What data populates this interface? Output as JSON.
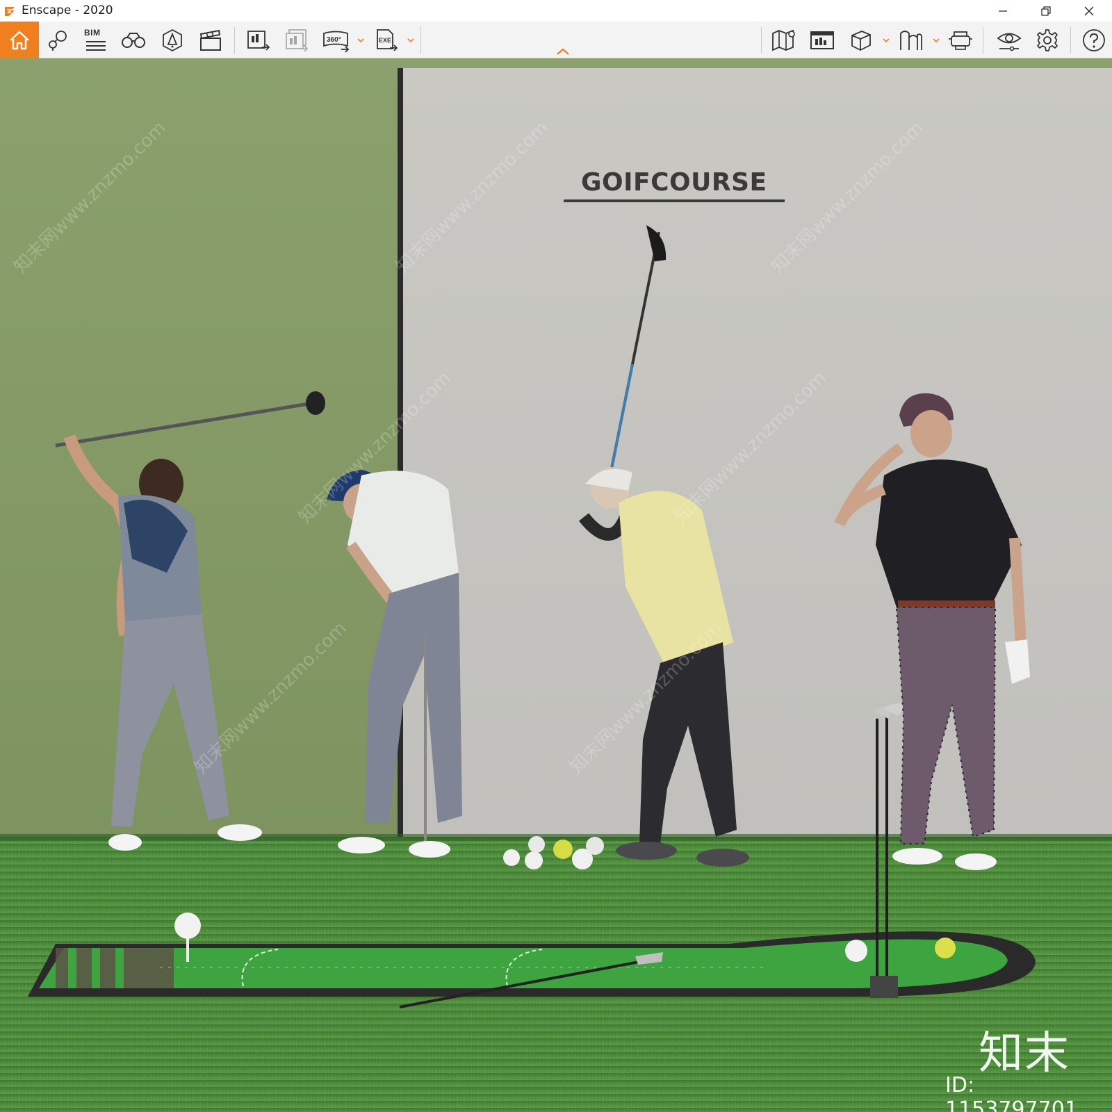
{
  "window": {
    "title": "Enscape - 2020",
    "controls": [
      "minimize-icon",
      "restore-icon",
      "close-icon"
    ]
  },
  "toolbar": {
    "accent_color": "#f07f1f",
    "bim_label": "BIM",
    "left_tools": [
      "home-icon",
      "views-pin-icon",
      "bim-list-icon",
      "binoculars-icon",
      "visual-settings-icon",
      "video-editor-icon"
    ],
    "export_tools": [
      "batch-render-icon",
      "render-panorama-icon",
      "export-360-icon",
      "export-exe-icon"
    ],
    "right_tools": [
      "map-icon",
      "asset-library-icon",
      "cube-view-icon",
      "material-editor-icon",
      "vr-headset-icon",
      "visibility-icon",
      "settings-icon",
      "help-icon"
    ]
  },
  "scene": {
    "sign_text": "GOIFCOURSE",
    "wall_colors": {
      "green": "#8a9c69",
      "gray": "#c6c4c0"
    },
    "grass_color": "#4f8a3b"
  },
  "watermark": {
    "brand": "知末",
    "id_text": "ID: 1153797701",
    "diagonal_text": "知末网www.znzmo.com"
  }
}
